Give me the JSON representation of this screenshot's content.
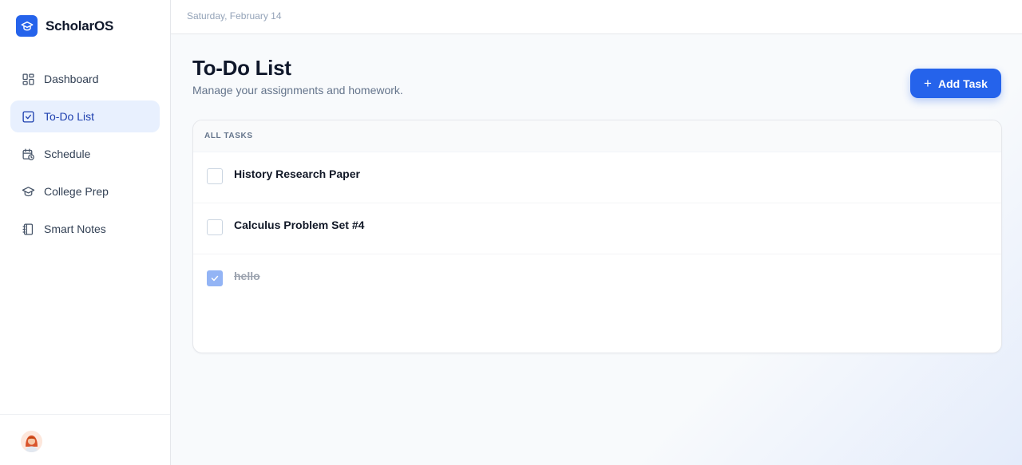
{
  "app": {
    "name": "ScholarOS",
    "logo_icon": "graduation-cap-icon",
    "accent": "#2563eb"
  },
  "sidebar": {
    "items": [
      {
        "label": "Dashboard",
        "icon": "dashboard-icon",
        "active": false
      },
      {
        "label": "To-Do List",
        "icon": "checkbox-icon",
        "active": true
      },
      {
        "label": "Schedule",
        "icon": "calendar-clock-icon",
        "active": false
      },
      {
        "label": "College Prep",
        "icon": "graduation-cap-icon",
        "active": false
      },
      {
        "label": "Smart Notes",
        "icon": "notebook-icon",
        "active": false
      }
    ]
  },
  "topbar": {
    "date": "Saturday, February 14"
  },
  "page": {
    "title": "To-Do List",
    "subtitle": "Manage your assignments and homework.",
    "add_button": "Add Task"
  },
  "tasks": {
    "header": "ALL TASKS",
    "items": [
      {
        "title": "History Research Paper",
        "done": false
      },
      {
        "title": "Calculus Problem Set #4",
        "done": false
      },
      {
        "title": "hello",
        "done": true
      }
    ]
  }
}
